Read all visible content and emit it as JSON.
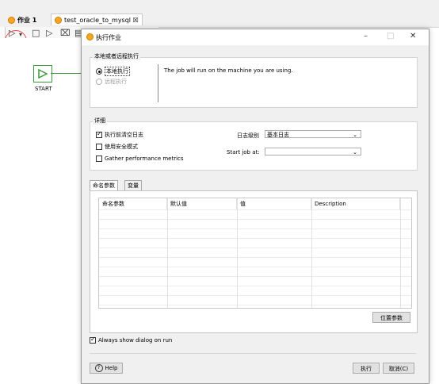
{
  "editor": {
    "tabs": [
      {
        "label": "作业 1"
      },
      {
        "label": "test_oracle_to_mysql ☒"
      }
    ],
    "toolbar_icons": [
      "play-icon",
      "stop-icon",
      "preview-icon",
      "debug-icon",
      "page-icon"
    ],
    "start_node_label": "START"
  },
  "dialog": {
    "title": "执行作业",
    "window_buttons": {
      "minimize": "–",
      "maximize": "□",
      "close": "✕"
    },
    "location": {
      "group_label": "本地或者远程执行",
      "local": "本地执行",
      "remote": "远程执行",
      "description": "The job will run on the machine you are using."
    },
    "details": {
      "group_label": "详细",
      "clear_log": "执行前清空日志",
      "safe_mode": "使用安全模式",
      "gather_metrics": "Gather performance metrics",
      "log_level_label": "日志级别",
      "log_level_value": "基本日志",
      "start_job_label": "Start job at:",
      "start_job_value": ""
    },
    "tabs": {
      "named_params": "命名参数",
      "variables": "变量"
    },
    "table": {
      "columns": [
        "命名参数",
        "默认值",
        "值",
        "Description"
      ],
      "row_count": 10
    },
    "position_params_button": "位置参数",
    "always_show": "Always show dialog on run",
    "help_button": "Help",
    "run_button": "执行",
    "cancel_button": "取消(C)"
  },
  "colors": {
    "accent_orange": "#f5a623",
    "start_green": "#3c9a3c",
    "annotation_red": "#e05050"
  }
}
